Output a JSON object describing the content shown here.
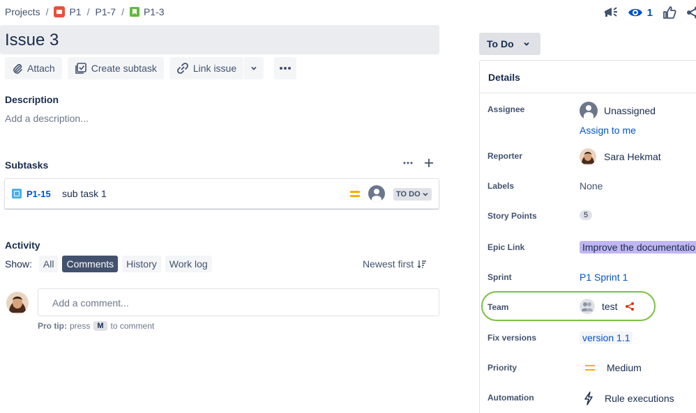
{
  "breadcrumb": {
    "projects": "Projects",
    "project": "P1",
    "parent": "P1-7",
    "issue": "P1-3"
  },
  "header": {
    "watch_count": "1"
  },
  "issue": {
    "title": "Issue 3"
  },
  "toolbar": {
    "attach": "Attach",
    "create_subtask": "Create subtask",
    "link_issue": "Link issue"
  },
  "description": {
    "label": "Description",
    "placeholder": "Add a description..."
  },
  "subtasks": {
    "label": "Subtasks",
    "items": [
      {
        "key": "P1-15",
        "summary": "sub task 1",
        "status": "TO DO"
      }
    ]
  },
  "activity": {
    "label": "Activity",
    "show_label": "Show:",
    "filters": [
      "All",
      "Comments",
      "History",
      "Work log"
    ],
    "active_filter": "Comments",
    "sort": "Newest first",
    "comment_placeholder": "Add a comment...",
    "protip_bold": "Pro tip:",
    "protip_press": "press",
    "protip_key": "M",
    "protip_rest": "to comment"
  },
  "status_button": "To Do",
  "details": {
    "title": "Details",
    "fields": {
      "assignee": {
        "label": "Assignee",
        "value": "Unassigned",
        "action": "Assign to me"
      },
      "reporter": {
        "label": "Reporter",
        "value": "Sara Hekmat"
      },
      "labels": {
        "label": "Labels",
        "value": "None"
      },
      "story_points": {
        "label": "Story Points",
        "value": "5"
      },
      "epic_link": {
        "label": "Epic Link",
        "value": "Improve the documentatio"
      },
      "sprint": {
        "label": "Sprint",
        "value": "P1 Sprint 1"
      },
      "team": {
        "label": "Team",
        "value": "test"
      },
      "fix_versions": {
        "label": "Fix versions",
        "value": "version 1.1"
      },
      "priority": {
        "label": "Priority",
        "value": "Medium"
      },
      "automation": {
        "label": "Automation",
        "value": "Rule executions"
      }
    }
  },
  "colors": {
    "primary_link": "#0052cc",
    "team_highlight": "#7bc043",
    "epic_bg": "#c0b6f2",
    "priority_medium": "#ffab00",
    "active_filter_bg": "#42526e"
  },
  "icons": {
    "project": "project-avatar-icon",
    "story": "story-icon",
    "announce": "megaphone-icon",
    "watch": "eye-icon",
    "vote": "thumbs-up-icon",
    "share": "share-icon"
  }
}
